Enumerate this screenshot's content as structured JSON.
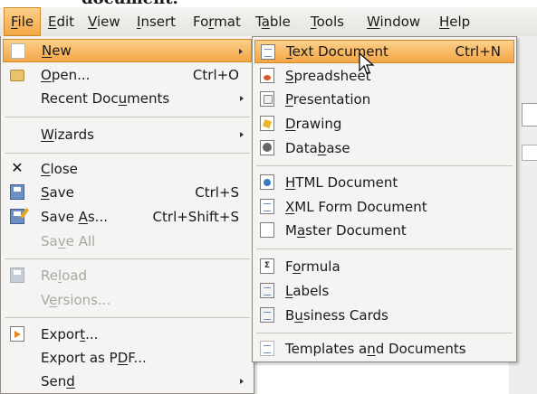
{
  "menubar": {
    "items": [
      {
        "label": "File",
        "u": "F",
        "rest": "ile"
      },
      {
        "label": "Edit",
        "u": "E",
        "rest": "dit"
      },
      {
        "label": "View",
        "u": "V",
        "rest": "iew"
      },
      {
        "label": "Insert",
        "u": "I",
        "rest": "nsert"
      },
      {
        "label": "Format",
        "pre": "Fo",
        "u": "r",
        "rest": "mat"
      },
      {
        "label": "Table",
        "pre": "T",
        "u": "a",
        "rest": "ble"
      },
      {
        "label": "Tools",
        "u": "T",
        "rest": "ools"
      },
      {
        "label": "Window",
        "u": "W",
        "rest": "indow"
      },
      {
        "label": "Help",
        "u": "H",
        "rest": "elp"
      }
    ]
  },
  "file_menu": {
    "new": {
      "pre": "",
      "u": "N",
      "rest": "ew"
    },
    "open": {
      "pre": "",
      "u": "O",
      "rest": "pen...",
      "accel": "Ctrl+O"
    },
    "recent": {
      "pre": "Recent Doc",
      "u": "u",
      "rest": "ments"
    },
    "wizards": {
      "pre": "",
      "u": "W",
      "rest": "izards"
    },
    "close": {
      "pre": "",
      "u": "C",
      "rest": "lose"
    },
    "save": {
      "pre": "",
      "u": "S",
      "rest": "ave",
      "accel": "Ctrl+S"
    },
    "save_as": {
      "pre": "Save ",
      "u": "A",
      "rest": "s...",
      "accel": "Ctrl+Shift+S"
    },
    "save_all": {
      "pre": "Sa",
      "u": "v",
      "rest": "e All"
    },
    "reload": {
      "pre": "Re",
      "u": "l",
      "rest": "oad"
    },
    "versions": {
      "pre": "V",
      "u": "e",
      "rest": "rsions..."
    },
    "export": {
      "pre": "Expor",
      "u": "t",
      "rest": "..."
    },
    "export_pdf": {
      "pre": "Export as P",
      "u": "D",
      "rest": "F..."
    },
    "send": {
      "pre": "Sen",
      "u": "d",
      "rest": ""
    }
  },
  "new_menu": {
    "text_document": {
      "pre": "",
      "u": "T",
      "rest": "ext Document",
      "accel": "Ctrl+N"
    },
    "spreadsheet": {
      "pre": "",
      "u": "S",
      "rest": "preadsheet"
    },
    "presentation": {
      "pre": "",
      "u": "P",
      "rest": "resentation"
    },
    "drawing": {
      "pre": "",
      "u": "D",
      "rest": "rawing"
    },
    "database": {
      "pre": "Data",
      "u": "b",
      "rest": "ase"
    },
    "html_document": {
      "pre": "",
      "u": "H",
      "rest": "TML Document"
    },
    "xml_form_document": {
      "pre": "",
      "u": "X",
      "rest": "ML Form Document"
    },
    "master_document": {
      "pre": "M",
      "u": "a",
      "rest": "ster Document"
    },
    "formula": {
      "pre": "F",
      "u": "o",
      "rest": "rmula"
    },
    "labels": {
      "pre": "",
      "u": "L",
      "rest": "abels"
    },
    "business_cards": {
      "pre": "B",
      "u": "u",
      "rest": "siness Cards"
    },
    "templates": {
      "pre": "Templates a",
      "u": "n",
      "rest": "d Documents"
    }
  },
  "top_title": "document.",
  "colors": {
    "highlight": "#f3a646",
    "menu_bg": "#f5f4f2",
    "disabled": "#a9a7a3"
  }
}
